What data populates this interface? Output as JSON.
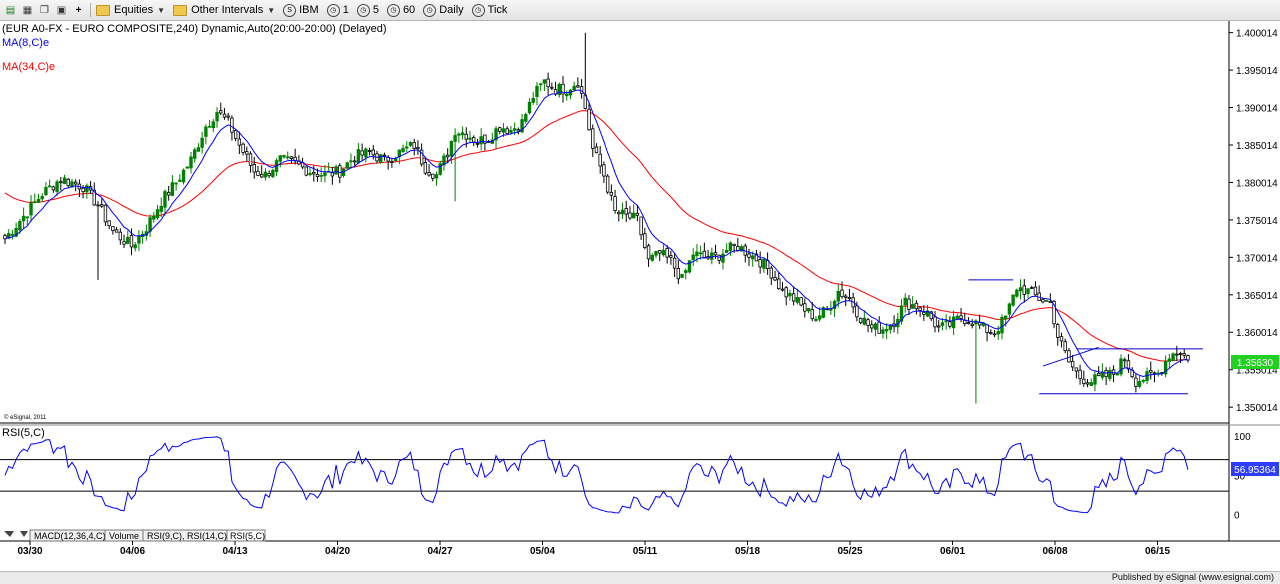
{
  "toolbar": {
    "equities_label": "Equities",
    "other_intervals_label": "Other Intervals",
    "intervals": [
      "IBM",
      "1",
      "5",
      "60",
      "Daily",
      "Tick"
    ]
  },
  "chart_header": {
    "title": "(EUR A0-FX - EURO COMPOSITE,240) Dynamic,Auto(20:00-20:00) (Delayed)",
    "ma8_label": "MA(8,C)e",
    "ma34_label": "MA(34,C)e",
    "rsi_label": "RSI(5,C)",
    "copyright": "© eSignal, 2011"
  },
  "tabs": [
    "MACD(12,36,4,C)",
    "Volume",
    "RSI(9,C), RSI(14,C)",
    "RSI(5,C)"
  ],
  "footer_text": "Published by eSignal (www.esignal.com)",
  "colors": {
    "up": "#008000",
    "down": "#000000",
    "ma8": "#0000ff",
    "ma34": "#ff0000",
    "rsi": "#0000ff",
    "last_price_bg": "#22d022"
  },
  "chart_data": [
    {
      "type": "candlestick",
      "title": "(EUR A0-FX - EURO COMPOSITE,240) Dynamic,Auto(20:00-20:00) (Delayed)",
      "x_tick_labels": [
        "03/30",
        "04/06",
        "04/13",
        "04/20",
        "04/27",
        "05/04",
        "05/11",
        "05/18",
        "05/25",
        "06/01",
        "06/08",
        "06/15"
      ],
      "y_tick_labels": [
        "1.400014",
        "1.395014",
        "1.390014",
        "1.385014",
        "1.380014",
        "1.375014",
        "1.370014",
        "1.365014",
        "1.360014",
        "1.355014",
        "1.350014"
      ],
      "ylim": [
        1.3495,
        1.4005
      ],
      "last_price": "1.35630",
      "series_names": [
        "MA(8,C)e",
        "MA(34,C)e"
      ],
      "price_path": [
        [
          0,
          1.3725
        ],
        [
          10,
          1.3785
        ],
        [
          15,
          1.3805
        ],
        [
          21,
          1.3795
        ],
        [
          25,
          1.377
        ],
        [
          29,
          1.3735
        ],
        [
          34,
          1.3715
        ],
        [
          38,
          1.374
        ],
        [
          42,
          1.3775
        ],
        [
          46,
          1.38
        ],
        [
          50,
          1.383
        ],
        [
          54,
          1.3875
        ],
        [
          57,
          1.3895
        ],
        [
          60,
          1.388
        ],
        [
          63,
          1.385
        ],
        [
          67,
          1.3815
        ],
        [
          70,
          1.381
        ],
        [
          74,
          1.383
        ],
        [
          78,
          1.3825
        ],
        [
          82,
          1.3815
        ],
        [
          86,
          1.381
        ],
        [
          90,
          1.3815
        ],
        [
          94,
          1.3835
        ],
        [
          98,
          1.384
        ],
        [
          102,
          1.383
        ],
        [
          106,
          1.384
        ],
        [
          110,
          1.385
        ],
        [
          113,
          1.382
        ],
        [
          116,
          1.381
        ],
        [
          119,
          1.384
        ],
        [
          121,
          1.387
        ],
        [
          124,
          1.3865
        ],
        [
          127,
          1.3855
        ],
        [
          130,
          1.386
        ],
        [
          133,
          1.3875
        ],
        [
          136,
          1.387
        ],
        [
          139,
          1.388
        ],
        [
          142,
          1.3915
        ],
        [
          145,
          1.3935
        ],
        [
          148,
          1.3925
        ],
        [
          151,
          1.3925
        ],
        [
          154,
          1.3935
        ],
        [
          156,
          1.39
        ],
        [
          158,
          1.3845
        ],
        [
          161,
          1.381
        ],
        [
          164,
          1.376
        ],
        [
          167,
          1.3755
        ],
        [
          170,
          1.375
        ],
        [
          173,
          1.3695
        ],
        [
          176,
          1.3705
        ],
        [
          179,
          1.3695
        ],
        [
          182,
          1.367
        ],
        [
          185,
          1.3705
        ],
        [
          188,
          1.37
        ],
        [
          191,
          1.37
        ],
        [
          194,
          1.371
        ],
        [
          197,
          1.3715
        ],
        [
          200,
          1.3705
        ],
        [
          203,
          1.3695
        ],
        [
          206,
          1.368
        ],
        [
          209,
          1.3655
        ],
        [
          212,
          1.3645
        ],
        [
          215,
          1.363
        ],
        [
          218,
          1.362
        ],
        [
          221,
          1.363
        ],
        [
          224,
          1.3655
        ],
        [
          227,
          1.3645
        ],
        [
          230,
          1.362
        ],
        [
          233,
          1.3605
        ],
        [
          236,
          1.3605
        ],
        [
          239,
          1.3615
        ],
        [
          242,
          1.364
        ],
        [
          245,
          1.3635
        ],
        [
          248,
          1.3625
        ],
        [
          251,
          1.3605
        ],
        [
          254,
          1.361
        ],
        [
          257,
          1.362
        ],
        [
          260,
          1.3615
        ],
        [
          263,
          1.3605
        ],
        [
          266,
          1.36
        ],
        [
          269,
          1.362
        ],
        [
          272,
          1.366
        ],
        [
          275,
          1.3655
        ],
        [
          278,
          1.3645
        ],
        [
          281,
          1.364
        ],
        [
          283,
          1.3595
        ],
        [
          286,
          1.356
        ],
        [
          289,
          1.354
        ],
        [
          292,
          1.3535
        ],
        [
          295,
          1.354
        ],
        [
          298,
          1.3545
        ],
        [
          301,
          1.3565
        ],
        [
          304,
          1.3535
        ],
        [
          307,
          1.354
        ],
        [
          310,
          1.3545
        ],
        [
          313,
          1.357
        ],
        [
          316,
          1.3575
        ],
        [
          318,
          1.3563
        ]
      ],
      "overlay_lines": [
        {
          "x": [
            259,
            271
          ],
          "y": [
            1.367,
            1.367
          ]
        },
        {
          "x": [
            279,
            294
          ],
          "y": [
            1.3555,
            1.358
          ]
        },
        {
          "x": [
            288,
            322
          ],
          "y": [
            1.3578,
            1.3578
          ]
        },
        {
          "x": [
            278,
            318
          ],
          "y": [
            1.3518,
            1.3518
          ]
        }
      ]
    },
    {
      "type": "line",
      "title": "RSI(5,C)",
      "y_tick_labels": [
        "100",
        "50",
        "0"
      ],
      "ylim": [
        -8,
        105
      ],
      "reference_levels": [
        70,
        30
      ],
      "last_value": "56.95364"
    }
  ]
}
